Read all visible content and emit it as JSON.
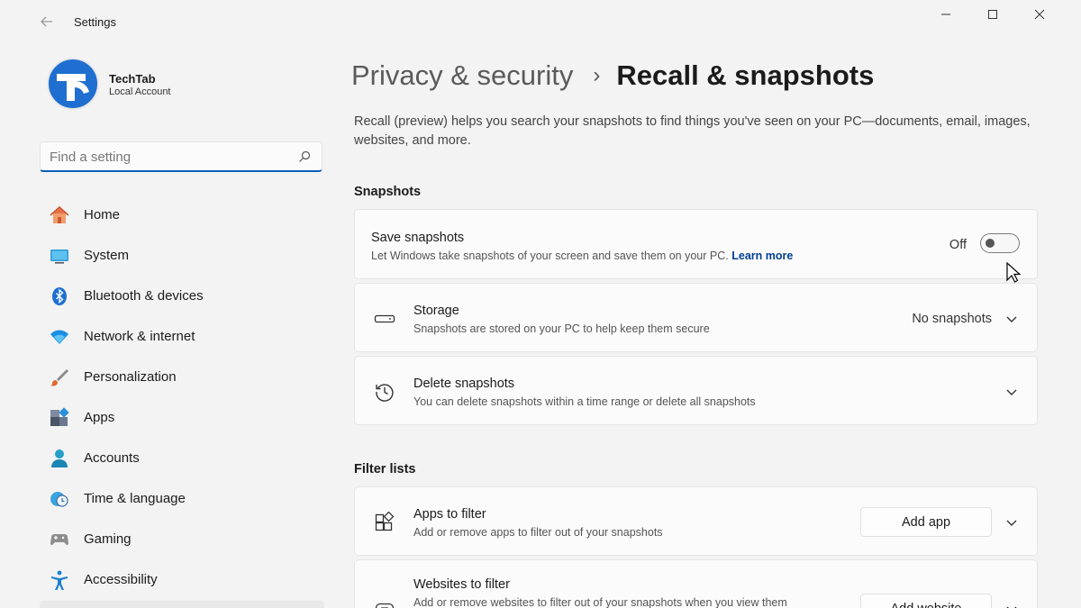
{
  "window": {
    "title": "Settings"
  },
  "profile": {
    "name": "TechTab",
    "account_type": "Local Account"
  },
  "search": {
    "placeholder": "Find a setting"
  },
  "sidebar": {
    "items": [
      {
        "label": "Home",
        "icon": "home-icon"
      },
      {
        "label": "System",
        "icon": "system-icon"
      },
      {
        "label": "Bluetooth & devices",
        "icon": "bluetooth-icon"
      },
      {
        "label": "Network & internet",
        "icon": "wifi-icon"
      },
      {
        "label": "Personalization",
        "icon": "brush-icon"
      },
      {
        "label": "Apps",
        "icon": "apps-icon"
      },
      {
        "label": "Accounts",
        "icon": "person-icon"
      },
      {
        "label": "Time & language",
        "icon": "clock-globe-icon"
      },
      {
        "label": "Gaming",
        "icon": "controller-icon"
      },
      {
        "label": "Accessibility",
        "icon": "accessibility-icon"
      }
    ]
  },
  "header": {
    "parent": "Privacy & security",
    "separator": "›",
    "current": "Recall & snapshots"
  },
  "description": "Recall (preview) helps you search your snapshots to find things you've seen on your PC—documents, email, images, websites, and more.",
  "sections": {
    "snapshots_title": "Snapshots",
    "filter_title": "Filter lists"
  },
  "save_snapshots": {
    "title": "Save snapshots",
    "subtitle": "Let Windows take snapshots of your screen and save them on your PC.",
    "learn_more": "Learn more",
    "state": "Off"
  },
  "storage": {
    "title": "Storage",
    "subtitle": "Snapshots are stored on your PC to help keep them secure",
    "value": "No snapshots"
  },
  "delete_snapshots": {
    "title": "Delete snapshots",
    "subtitle": "You can delete snapshots within a time range or delete all snapshots"
  },
  "apps_filter": {
    "title": "Apps to filter",
    "subtitle": "Add or remove apps to filter out of your snapshots",
    "button": "Add app"
  },
  "websites_filter": {
    "title": "Websites to filter",
    "subtitle": "Add or remove websites to filter out of your snapshots when you view them",
    "button": "Add website"
  },
  "colors": {
    "accent": "#005fb8",
    "link": "#003e92",
    "avatar": "#1f6fd1"
  }
}
